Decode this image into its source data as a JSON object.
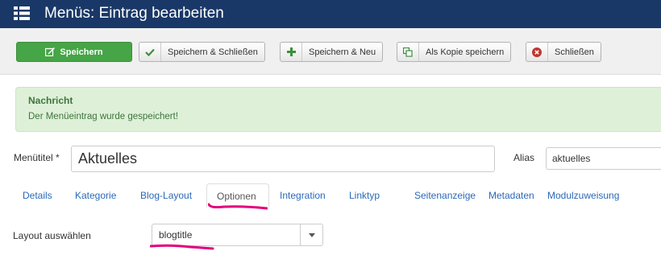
{
  "header": {
    "title": "Menüs: Eintrag bearbeiten",
    "icon": "list-icon"
  },
  "toolbar": {
    "save": "Speichern",
    "save_close": "Speichern & Schließen",
    "save_new": "Speichern & Neu",
    "save_copy": "Als Kopie speichern",
    "close": "Schließen"
  },
  "message": {
    "heading": "Nachricht",
    "text": "Der Menüeintrag wurde gespeichert!"
  },
  "form": {
    "title_label": "Menütitel *",
    "title_value": "Aktuelles",
    "alias_label": "Alias",
    "alias_value": "aktuelles"
  },
  "tabs": [
    "Details",
    "Kategorie",
    "Blog-Layout",
    "Optionen",
    "Integration",
    "Linktyp",
    "Seitenanzeige",
    "Metadaten",
    "Modulzuweisung"
  ],
  "active_tab": "Optionen",
  "layout": {
    "label": "Layout auswählen",
    "value": "blogtitle"
  },
  "colors": {
    "header_bg": "#1a3867",
    "save_green": "#46a546",
    "alert_bg": "#dff0d8",
    "link": "#2a69b8",
    "highlight": "#e4007c"
  }
}
